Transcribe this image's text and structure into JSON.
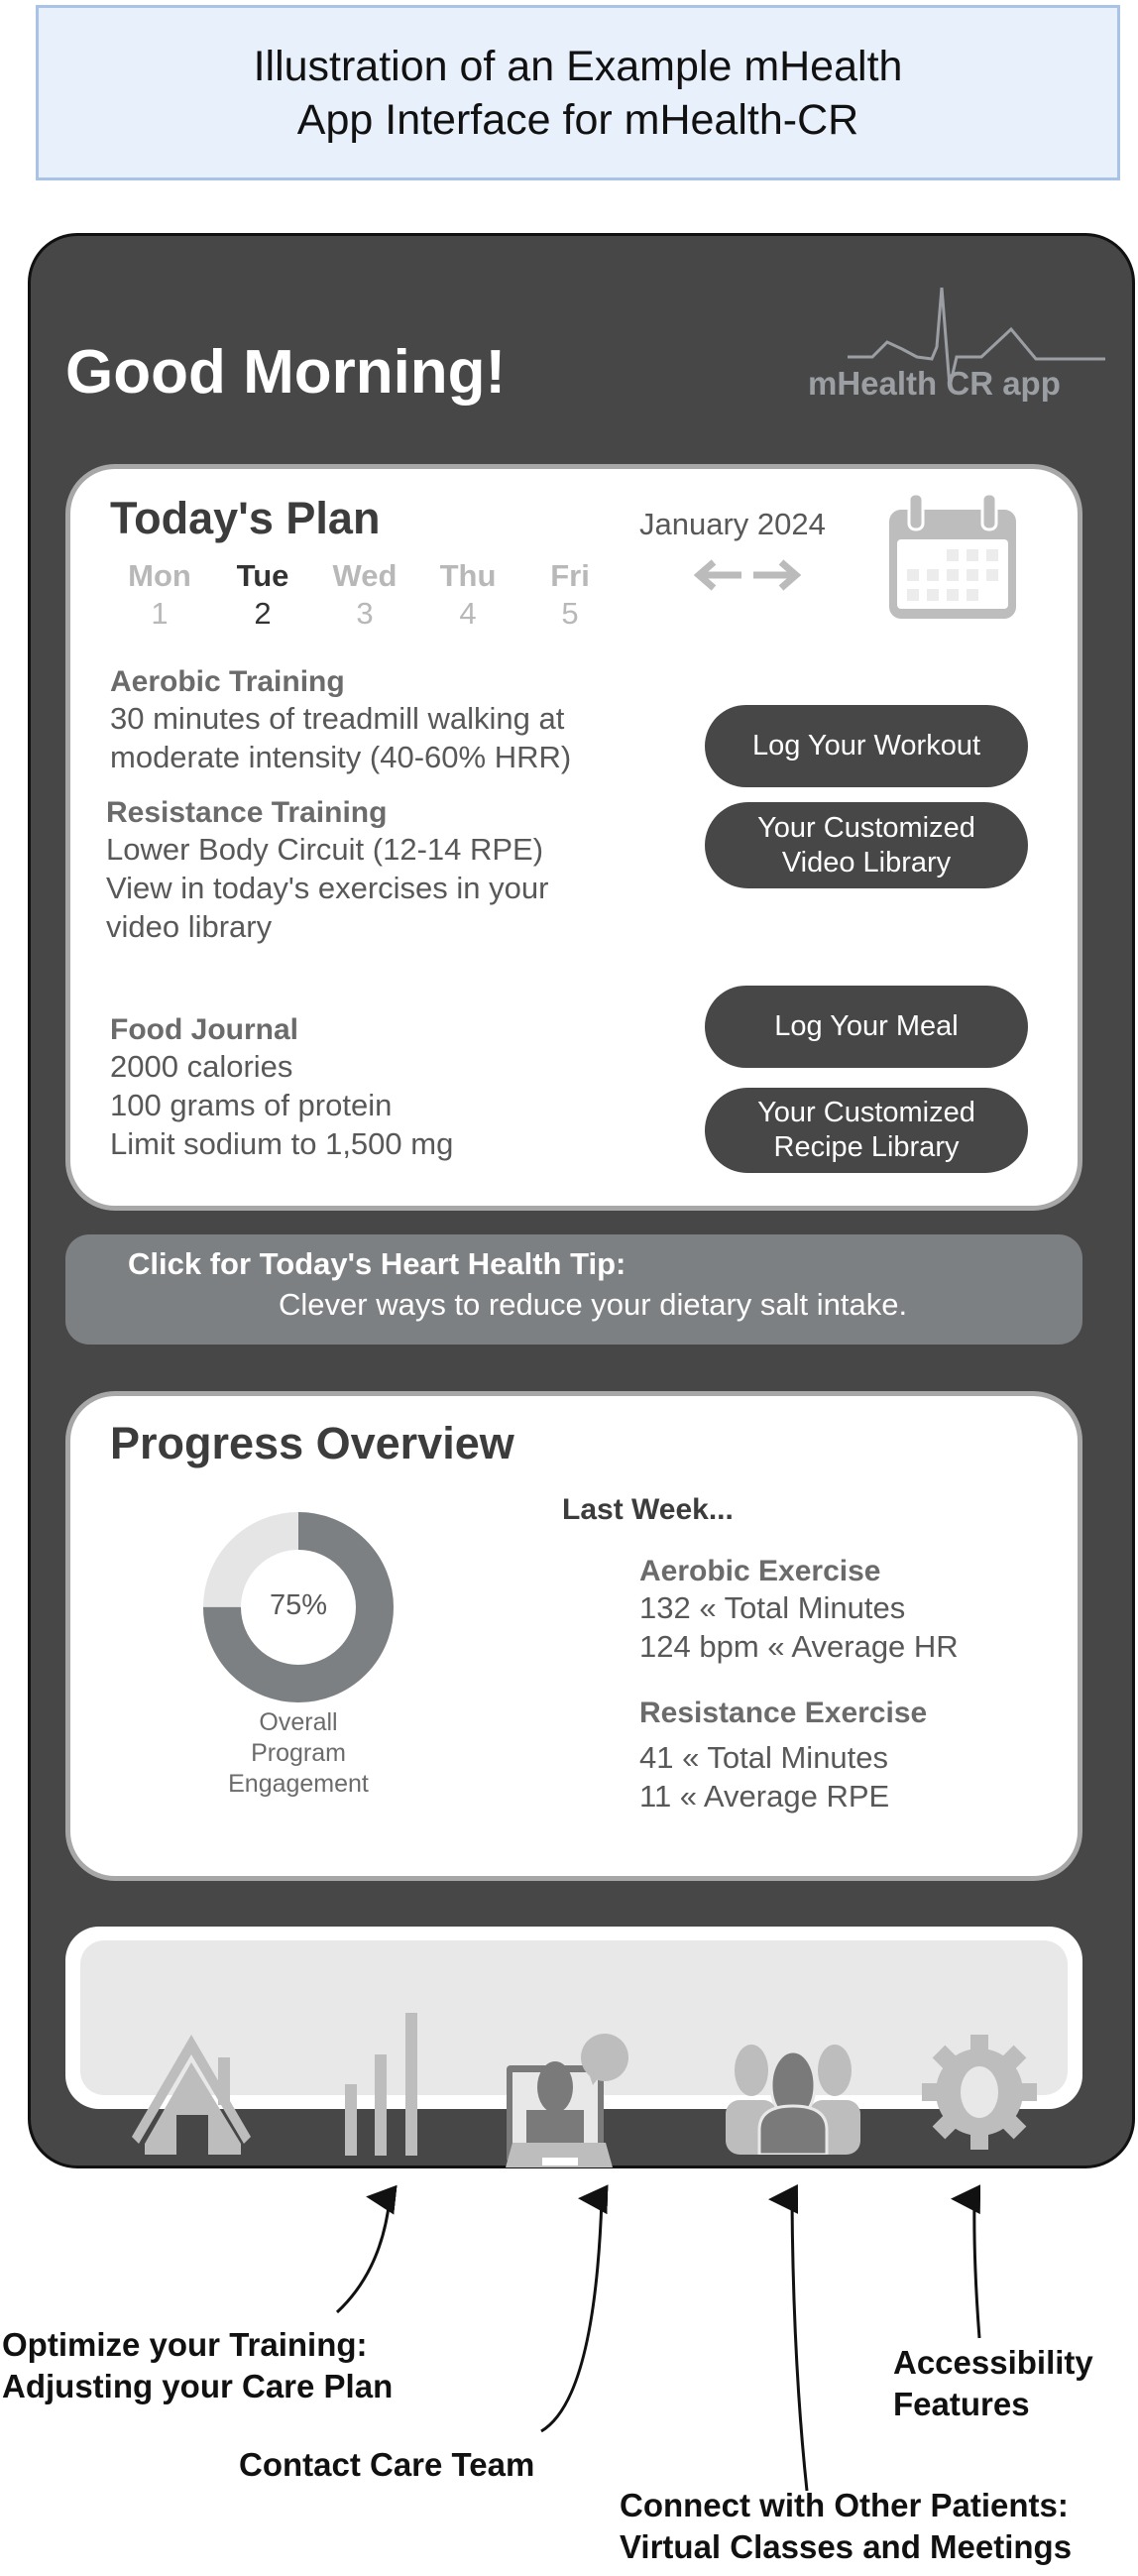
{
  "header": {
    "title_lines": [
      "Illustration of an Example mHealth",
      "App Interface for mHealth-CR"
    ]
  },
  "app": {
    "greeting": "Good Morning!",
    "logo_text": "mHealth CR app",
    "plan": {
      "title": "Today's Plan",
      "month": "January 2024",
      "days": [
        {
          "name": "Mon",
          "num": "1"
        },
        {
          "name": "Tue",
          "num": "2",
          "selected": true
        },
        {
          "name": "Wed",
          "num": "3"
        },
        {
          "name": "Thu",
          "num": "4"
        },
        {
          "name": "Fri",
          "num": "5"
        }
      ],
      "aerobic": {
        "title": "Aerobic Training",
        "lines": [
          "30 minutes of treadmill walking at",
          "moderate intensity (40-60% HRR)"
        ]
      },
      "resistance": {
        "title": "Resistance Training",
        "lines": [
          "Lower Body Circuit (12-14 RPE)",
          "View in today's exercises in your",
          "video library"
        ]
      },
      "food": {
        "title": "Food Journal",
        "lines": [
          "2000 calories",
          "100 grams of protein",
          "Limit sodium to 1,500 mg"
        ]
      },
      "buttons": {
        "log_workout": "Log Your Workout",
        "video_library": [
          "Your Customized",
          "Video Library"
        ],
        "log_meal": "Log Your Meal",
        "recipe_library": [
          "Your Customized",
          "Recipe Library"
        ]
      }
    },
    "tip": {
      "title": "Click for Today's Heart Health Tip:",
      "text": "Clever ways to reduce your dietary salt intake."
    },
    "progress": {
      "title": "Progress Overview",
      "engagement_percent": 75,
      "engagement_label": "75%",
      "engagement_caption": [
        "Overall",
        "Program",
        "Engagement"
      ],
      "last_week": "Last Week...",
      "aerobic": {
        "title": "Aerobic Exercise",
        "lines": [
          "132 « Total Minutes",
          "124 bpm « Average HR"
        ]
      },
      "resistance": {
        "title": "Resistance Exercise",
        "lines": [
          "41 « Total Minutes",
          "11 « Average RPE"
        ]
      }
    },
    "nav": [
      "home-icon",
      "progress-bars-icon",
      "telehealth-doctor-icon",
      "community-group-icon",
      "settings-gear-icon"
    ]
  },
  "annotations": {
    "training": [
      "Optimize your Training:",
      "Adjusting your Care Plan"
    ],
    "care_team": "Contact Care Team",
    "patients": [
      "Connect with Other Patients:",
      "Virtual Classes and Meetings"
    ],
    "accessibility": [
      "Accessibility",
      "Features"
    ]
  },
  "colors": {
    "phone": "#474747",
    "title_bg": "#e8f0fb",
    "title_border": "#a9c3e6",
    "tip_bg": "#7d8083",
    "donut": "#7d8083"
  }
}
